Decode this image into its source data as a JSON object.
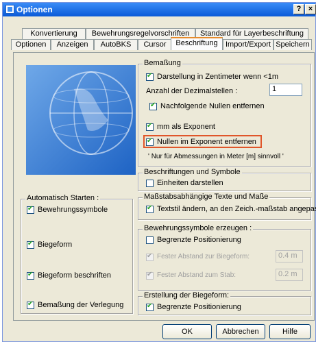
{
  "window": {
    "title": "Optionen",
    "help_label": "?",
    "close_label": "×"
  },
  "tabs_row1": [
    "Konvertierung",
    "Bewehrungsregelvorschriften",
    "Standard für Layerbeschriftung"
  ],
  "tabs_row2": [
    "Optionen",
    "Anzeigen",
    "AutoBKS",
    "Cursor",
    "Beschriftung",
    "Import/Export",
    "Speichern"
  ],
  "active_tab": "Beschriftung",
  "bemassung": {
    "title": "Bemaßung",
    "cm_label": "Darstellung in Zentimeter wenn <1m",
    "decimals_label": "Anzahl der Dezimalstellen :",
    "decimals_value": "1",
    "trailing_zeros_label": "Nachfolgende Nullen entfernen",
    "mm_exp_label": "mm als Exponent",
    "zero_exp_label": "Nullen im Exponent entfernen",
    "note": "' Nur für Abmessungen in Meter [m] sinnvoll '"
  },
  "beschriftungen": {
    "title": "Beschriftungen und Symbole",
    "units_label": "Einheiten darstellen"
  },
  "auto_start": {
    "title": "Automatisch Starten :",
    "items": [
      "Bewehrungssymbole",
      "Biegeform",
      "Biegeform beschriften",
      "Bemaßung der Verlegung"
    ]
  },
  "massstab": {
    "title": "Maßstabsabhängige Texte und Maße",
    "text_label": "Textstil ändern, an den Zeich.-maßstab angepasst"
  },
  "bewehrung": {
    "title": "Bewehrungssymbole erzeugen :",
    "limit_label": "Begrenzte Positionierung",
    "dist_biege_label": "Fester Abstand zur Biegeform:",
    "dist_biege_value": "0.4 m",
    "dist_stab_label": "Fester Abstand zum Stab:",
    "dist_stab_value": "0.2 m"
  },
  "erstellung": {
    "title": "Erstellung der Biegeform:",
    "limit_label": "Begrenzte Positionierung"
  },
  "buttons": {
    "ok": "OK",
    "cancel": "Abbrechen",
    "help": "Hilfe"
  }
}
